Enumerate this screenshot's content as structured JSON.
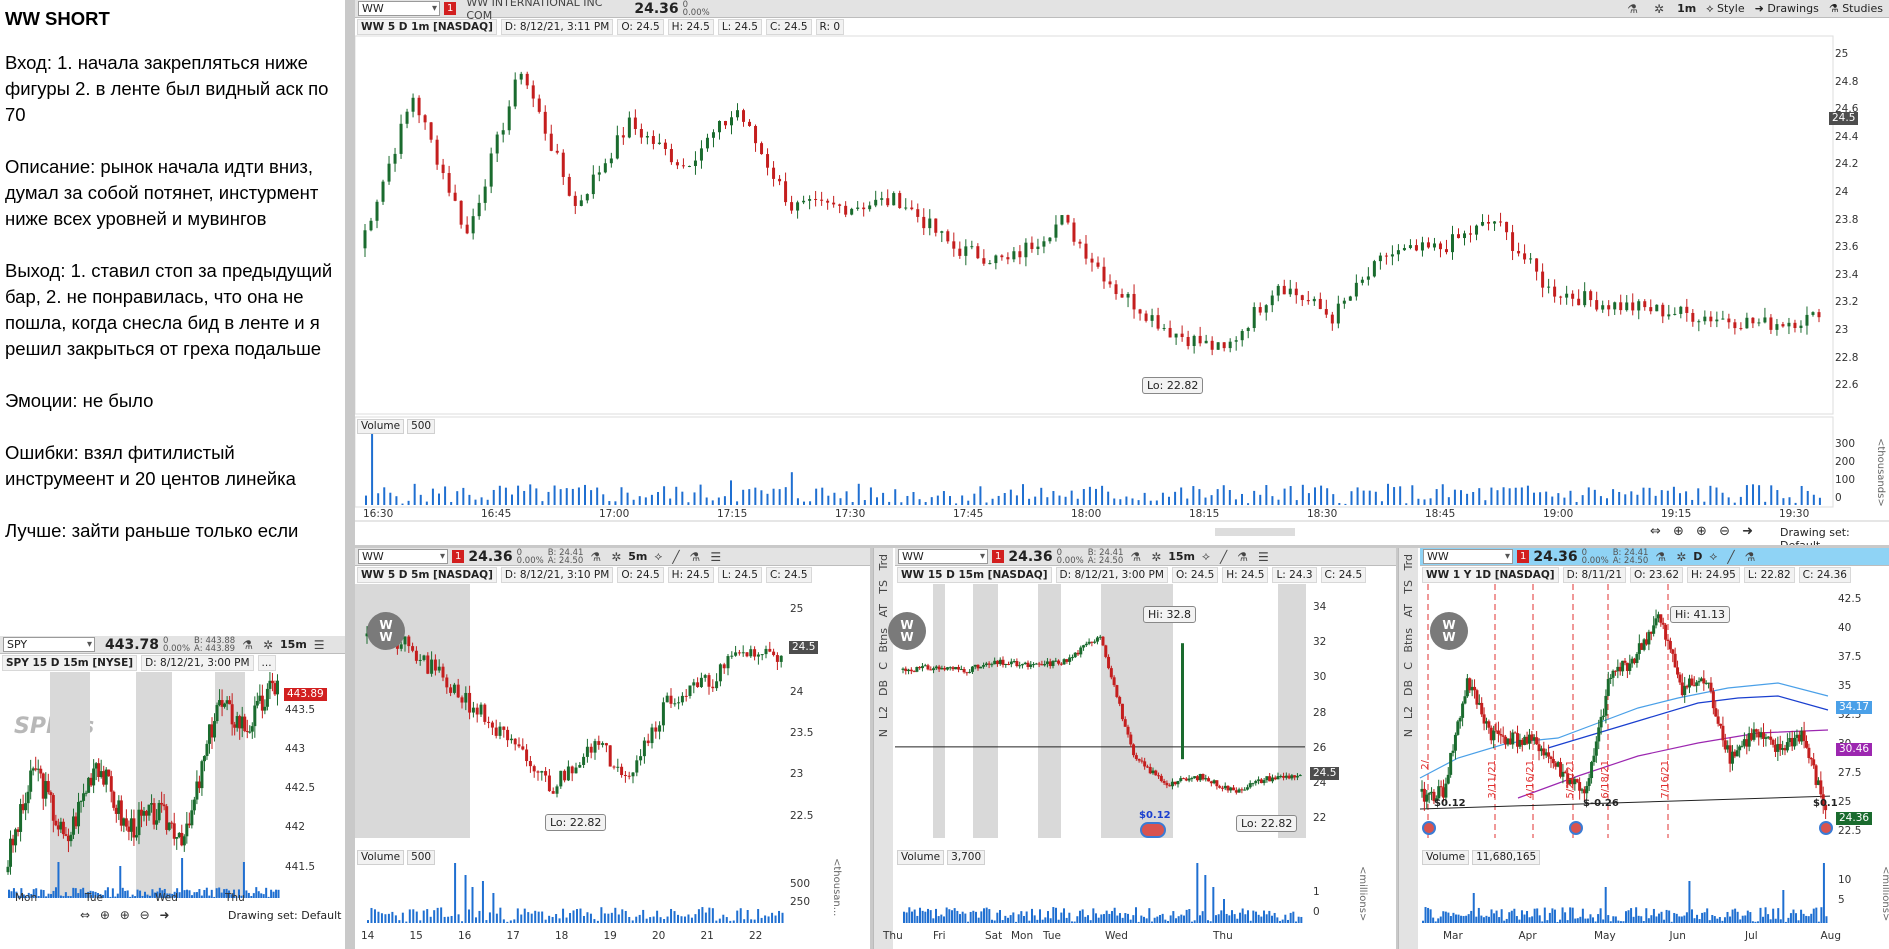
{
  "notes": {
    "title": "WW SHORT",
    "paragraphs": [
      "Вход: 1. начала закрепляться ниже фигуры 2. в ленте был видный аск по 70",
      "Описание: рынок начала идти вниз, думал за собой потянет, инстурмент ниже всех уровней и мувингов",
      "Выход: 1. ставил стоп за предыдущий бар, 2. не понравилась, что она не пошла, когда снесла бид в ленте и я решил закрыться от греха подальше",
      "Эмоции: не было",
      "Ошибки: взял фитилистый инструмеент и 20 центов линейка",
      "Лучше: зайти раньше только если"
    ]
  },
  "main": {
    "symbol": "WW",
    "company": "WW INTERNATIONAL INC COM",
    "price": "24.36",
    "change": "0",
    "change_pct": "0.00%",
    "toolbar": {
      "timeframe": "1m",
      "style": "Style",
      "drawings": "Drawings",
      "studies": "Studies"
    },
    "info": [
      "WW 5 D 1m [NASDAQ]",
      "D: 8/12/21, 3:11 PM",
      "O: 24.5",
      "H: 24.5",
      "L: 24.5",
      "C: 24.5",
      "R: 0"
    ],
    "yticks": [
      "25",
      "24.8",
      "24.6",
      "24.4",
      "24.2",
      "24",
      "23.8",
      "23.6",
      "23.4",
      "23.2",
      "23",
      "22.8",
      "22.6"
    ],
    "price_tag": "24.5",
    "low_tag": "Lo: 22.82",
    "volume_label": "Volume",
    "volume_value": "500",
    "vol_ticks": [
      "300",
      "200",
      "100",
      "0"
    ],
    "vol_unit": "<thousands>",
    "xticks": [
      "16:30",
      "16:45",
      "17:00",
      "17:15",
      "17:30",
      "17:45",
      "18:00",
      "18:15",
      "18:30",
      "18:45",
      "19:00",
      "19:15",
      "19:30"
    ],
    "drawing_set": "Drawing set: Default"
  },
  "spy": {
    "symbol": "SPY",
    "price": "443.78",
    "change": "0",
    "change_pct": "0.00%",
    "bid": "B: 443.88",
    "ask": "A: 443.89",
    "timeframe": "15m",
    "info": [
      "SPY 15 D 15m [NYSE]",
      "D: 8/12/21, 3:00 PM",
      "..."
    ],
    "logo": "SPDRs",
    "yticks": [
      "443.5",
      "443",
      "442.5",
      "442",
      "441.5"
    ],
    "price_tag": "443.89",
    "xticks": [
      "Mon",
      "Tue",
      "Wed",
      "Thu"
    ],
    "drawing_set": "Drawing set: Default"
  },
  "p5m": {
    "symbol": "WW",
    "price": "24.36",
    "change": "0",
    "change_pct": "0.00%",
    "bid": "B: 24.41",
    "ask": "A: 24.50",
    "timeframe": "5m",
    "info": [
      "WW 5 D 5m [NASDAQ]",
      "D: 8/12/21, 3:10 PM",
      "O: 24.5",
      "H: 24.5",
      "L: 24.5",
      "C: 24.5"
    ],
    "yticks": [
      "25",
      "24.5",
      "24",
      "23.5",
      "23",
      "22.5"
    ],
    "price_tag": "24.5",
    "low_tag": "Lo: 22.82",
    "volume_label": "Volume",
    "volume_value": "500",
    "vol_ticks": [
      "500",
      "250"
    ],
    "vol_unit": "<thousan...",
    "xticks": [
      "14",
      "15",
      "16",
      "17",
      "18",
      "19",
      "20",
      "21",
      "22"
    ]
  },
  "p15m": {
    "symbol": "WW",
    "price": "24.36",
    "change": "0",
    "change_pct": "0.00%",
    "bid": "B: 24.41",
    "ask": "A: 24.50",
    "timeframe": "15m",
    "info": [
      "WW 15 D 15m [NASDAQ]",
      "D: 8/12/21, 3:00 PM",
      "O: 24.5",
      "H: 24.5",
      "L: 24.3",
      "C: 24.5"
    ],
    "yticks": [
      "34",
      "32",
      "30",
      "28",
      "26",
      "24",
      "22"
    ],
    "price_tag": "24.5",
    "hi_tag": "Hi: 32.8",
    "low_tag": "Lo: 22.82",
    "event": "$0.12",
    "volume_label": "Volume",
    "volume_value": "3,700",
    "vol_ticks": [
      "1",
      "0"
    ],
    "vol_unit": "<millions>",
    "xticks": [
      "Thu",
      "Fri",
      "Sat",
      "Mon",
      "Tue",
      "Wed",
      "Thu"
    ],
    "side_tabs": [
      "Trd",
      "TS",
      "AT",
      "Btns",
      "C",
      "DB",
      "L2",
      "N"
    ]
  },
  "p1y": {
    "symbol": "WW",
    "price": "24.36",
    "change": "0",
    "change_pct": "0.00%",
    "bid": "B: 24.41",
    "ask": "A: 24.50",
    "timeframe": "D",
    "info": [
      "WW 1 Y 1D [NASDAQ]",
      "D: 8/11/21",
      "O: 23.62",
      "H: 24.95",
      "L: 22.82",
      "C: 24.36"
    ],
    "yticks": [
      "42.5",
      "40",
      "37.5",
      "35",
      "32.5",
      "30",
      "27.5",
      "25",
      "22.5"
    ],
    "tags": [
      "34.17",
      "30.46",
      "24.36"
    ],
    "hi_tag": "Hi: 41.13",
    "events": [
      "$0.12",
      "$-0.26",
      "$0.1"
    ],
    "vlines": [
      "2/",
      "3/11/21",
      "4/16/21",
      "5/21/21",
      "6/18/21",
      "7/16/21"
    ],
    "volume_label": "Volume",
    "volume_value": "11,680,165",
    "vol_ticks": [
      "10",
      "5"
    ],
    "vol_unit": "<millions>",
    "xticks": [
      "Mar",
      "Apr",
      "May",
      "Jun",
      "Jul",
      "Aug"
    ],
    "side_tabs": [
      "Trd",
      "TS",
      "AT",
      "Btns",
      "C",
      "DB",
      "L2",
      "N"
    ]
  },
  "colors": {
    "up": "#1a6b2e",
    "down": "#c41e1e",
    "volume": "#1f6fd1",
    "accent": "#d21f1f",
    "sma_blue": "#4aa0e8",
    "sma_navy": "#1a3fcf",
    "sma_purple": "#9c27b0"
  }
}
